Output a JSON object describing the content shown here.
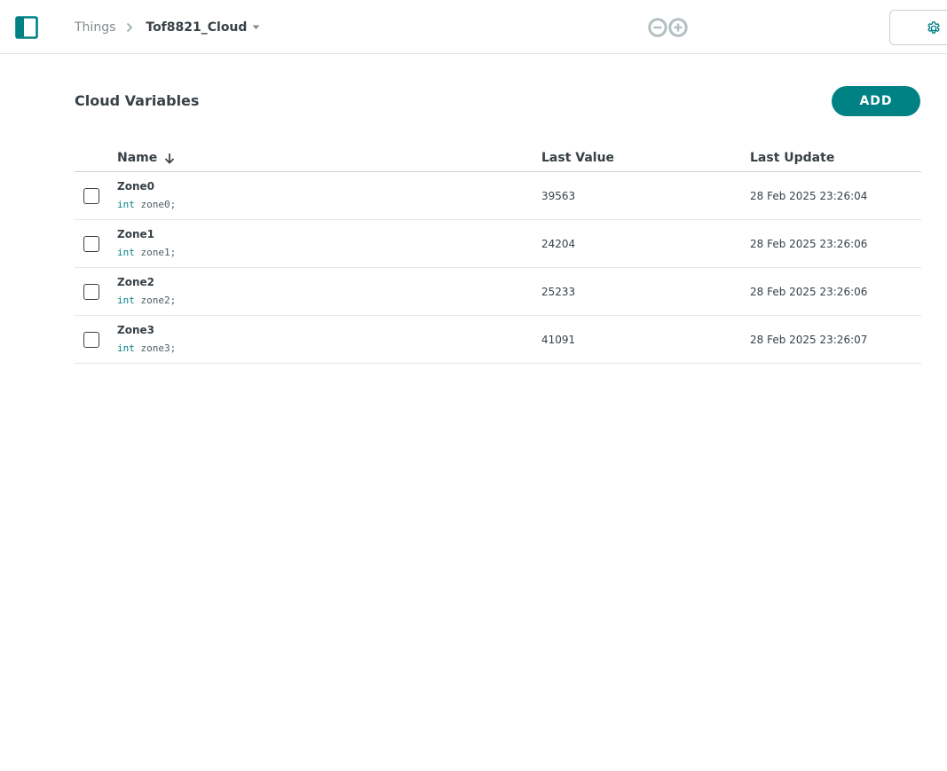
{
  "header": {
    "breadcrumb_root": "Things",
    "breadcrumb_current": "Tof8821_Cloud"
  },
  "section": {
    "title": "Cloud Variables",
    "add_label": "ADD"
  },
  "table": {
    "columns": {
      "name": "Name",
      "last_value": "Last Value",
      "last_update": "Last Update"
    },
    "rows": [
      {
        "name": "Zone0",
        "type": "int",
        "declaration": "zone0;",
        "value": "39563",
        "updated": "28 Feb 2025 23:26:04"
      },
      {
        "name": "Zone1",
        "type": "int",
        "declaration": "zone1;",
        "value": "24204",
        "updated": "28 Feb 2025 23:26:06"
      },
      {
        "name": "Zone2",
        "type": "int",
        "declaration": "zone2;",
        "value": "25233",
        "updated": "28 Feb 2025 23:26:06"
      },
      {
        "name": "Zone3",
        "type": "int",
        "declaration": "zone3;",
        "value": "41091",
        "updated": "28 Feb 2025 23:26:07"
      }
    ]
  },
  "icons": {
    "sidebar_toggle": "sidebar-toggle-icon",
    "breadcrumb_separator": "chevron-right-icon",
    "dropdown": "caret-down-icon",
    "logo": "arduino-logo",
    "settings": "gear-icon",
    "sort": "arrow-down-icon"
  },
  "colors": {
    "accent": "#008184",
    "text": "#374146",
    "muted": "#7f8c8d",
    "border": "#c9d2d2",
    "logo": "#b4bfc1"
  }
}
